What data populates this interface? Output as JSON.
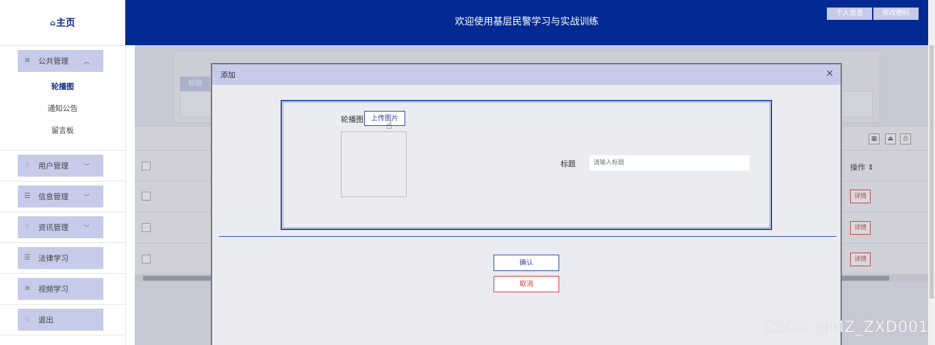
{
  "brand": {
    "icon": "home-icon",
    "label": "主页"
  },
  "header": {
    "title": "欢迎使用基层民警学习与实战训练",
    "btn_profile": "个人信息",
    "btn_password": "修改密码"
  },
  "sidebar": {
    "groups": [
      {
        "label": "公共管理",
        "icon": "layers-icon",
        "expanded": true,
        "items": [
          "轮播图",
          "通知公告",
          "留言板"
        ],
        "active_item": "轮播图"
      },
      {
        "label": "用户管理",
        "icon": "bell-icon",
        "expanded": false
      },
      {
        "label": "信息管理",
        "icon": "list-icon",
        "expanded": false
      },
      {
        "label": "资讯管理",
        "icon": "bell-icon",
        "expanded": false
      },
      {
        "label": "法律学习",
        "icon": "list-icon"
      },
      {
        "label": "视频学习",
        "icon": "layers-icon"
      },
      {
        "label": "退出",
        "icon": "bell-icon"
      }
    ]
  },
  "background_page": {
    "search_label": "标题",
    "table": {
      "ops_header": "操作",
      "rows": [
        {
          "action": "详情"
        },
        {
          "action": "详情"
        },
        {
          "action": "详情"
        }
      ]
    }
  },
  "modal": {
    "title": "添加",
    "close_icon": "close-icon",
    "carousel_label": "轮播图",
    "upload_button": "上传图片",
    "title_label": "标题",
    "title_placeholder": "请输入标题",
    "confirm": "确认",
    "cancel": "取消"
  },
  "watermark": "CSDN @MZ_ZXD001",
  "colors": {
    "header_bg": "#022a92",
    "accent_light": "#c5cbe9",
    "primary": "#2f4aa0",
    "danger": "#e03a3a"
  }
}
